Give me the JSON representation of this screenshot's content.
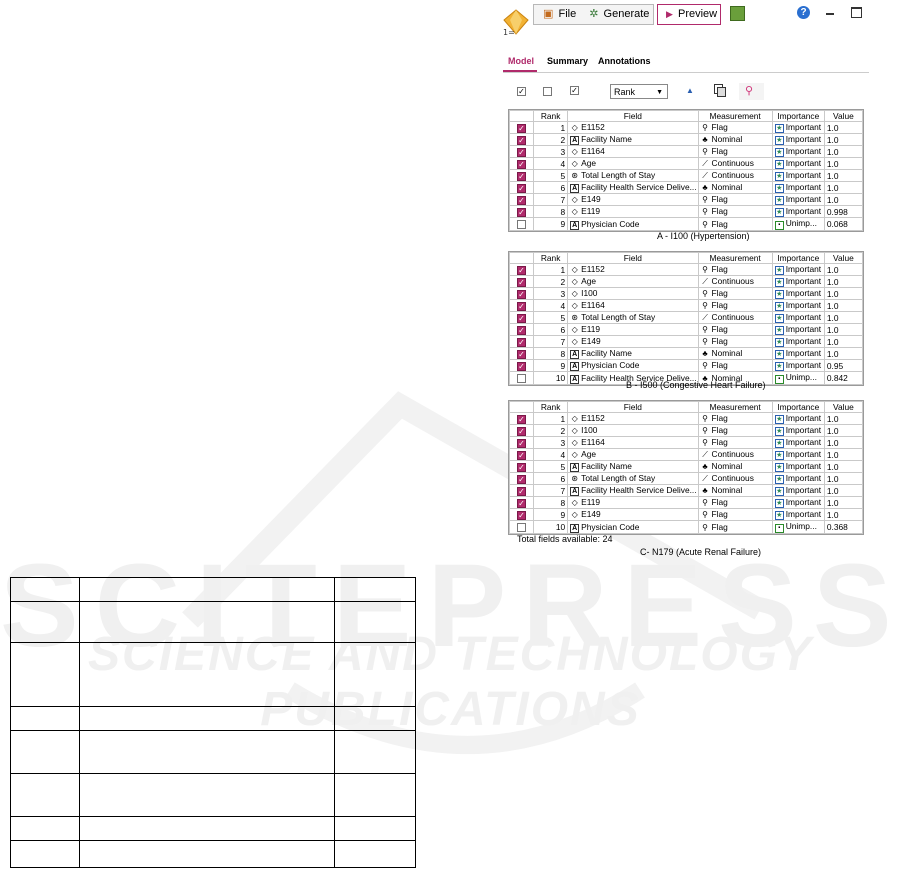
{
  "toolbar": {
    "file_label": "File",
    "generate_label": "Generate",
    "preview_label": "Preview"
  },
  "tabs": [
    "Model",
    "Summary",
    "Annotations"
  ],
  "sort_select": {
    "value": "Rank"
  },
  "columns": [
    "Rank",
    "Field",
    "Measurement",
    "Importance",
    "Value"
  ],
  "tables": [
    {
      "caption": "A - I100 (Hypertension)",
      "rows": [
        {
          "checked": true,
          "rank": "1",
          "icon": "flag",
          "field": "E1152",
          "mtype": "flag",
          "measurement": "Flag",
          "imp": "important",
          "importance": "Important",
          "value": "1.0"
        },
        {
          "checked": true,
          "rank": "2",
          "icon": "nominal",
          "field": "Facility Name",
          "mtype": "nominal",
          "measurement": "Nominal",
          "imp": "important",
          "importance": "Important",
          "value": "1.0"
        },
        {
          "checked": true,
          "rank": "3",
          "icon": "flag",
          "field": "E1164",
          "mtype": "flag",
          "measurement": "Flag",
          "imp": "important",
          "importance": "Important",
          "value": "1.0"
        },
        {
          "checked": true,
          "rank": "4",
          "icon": "flag",
          "field": "Age",
          "mtype": "continuous",
          "measurement": "Continuous",
          "imp": "important",
          "importance": "Important",
          "value": "1.0"
        },
        {
          "checked": true,
          "rank": "5",
          "icon": "continuous",
          "field": "Total Length of Stay",
          "mtype": "continuous",
          "measurement": "Continuous",
          "imp": "important",
          "importance": "Important",
          "value": "1.0"
        },
        {
          "checked": true,
          "rank": "6",
          "icon": "nominal",
          "field": "Facility Health Service Delive...",
          "mtype": "nominal",
          "measurement": "Nominal",
          "imp": "important",
          "importance": "Important",
          "value": "1.0"
        },
        {
          "checked": true,
          "rank": "7",
          "icon": "flag",
          "field": "E149",
          "mtype": "flag",
          "measurement": "Flag",
          "imp": "important",
          "importance": "Important",
          "value": "1.0"
        },
        {
          "checked": true,
          "rank": "8",
          "icon": "flag",
          "field": "E119",
          "mtype": "flag",
          "measurement": "Flag",
          "imp": "important",
          "importance": "Important",
          "value": "0.998"
        },
        {
          "checked": false,
          "rank": "9",
          "icon": "nominal",
          "field": "Physician Code",
          "mtype": "flag",
          "measurement": "Flag",
          "imp": "unimportant",
          "importance": "Unimp...",
          "value": "0.068"
        }
      ]
    },
    {
      "caption": "B - I500 (Congestive Heart Failure)",
      "rows": [
        {
          "checked": true,
          "rank": "1",
          "icon": "flag",
          "field": "E1152",
          "mtype": "flag",
          "measurement": "Flag",
          "imp": "important",
          "importance": "Important",
          "value": "1.0"
        },
        {
          "checked": true,
          "rank": "2",
          "icon": "flag",
          "field": "Age",
          "mtype": "continuous",
          "measurement": "Continuous",
          "imp": "important",
          "importance": "Important",
          "value": "1.0"
        },
        {
          "checked": true,
          "rank": "3",
          "icon": "flag",
          "field": "I100",
          "mtype": "flag",
          "measurement": "Flag",
          "imp": "important",
          "importance": "Important",
          "value": "1.0"
        },
        {
          "checked": true,
          "rank": "4",
          "icon": "flag",
          "field": "E1164",
          "mtype": "flag",
          "measurement": "Flag",
          "imp": "important",
          "importance": "Important",
          "value": "1.0"
        },
        {
          "checked": true,
          "rank": "5",
          "icon": "continuous",
          "field": "Total Length of Stay",
          "mtype": "continuous",
          "measurement": "Continuous",
          "imp": "important",
          "importance": "Important",
          "value": "1.0"
        },
        {
          "checked": true,
          "rank": "6",
          "icon": "flag",
          "field": "E119",
          "mtype": "flag",
          "measurement": "Flag",
          "imp": "important",
          "importance": "Important",
          "value": "1.0"
        },
        {
          "checked": true,
          "rank": "7",
          "icon": "flag",
          "field": "E149",
          "mtype": "flag",
          "measurement": "Flag",
          "imp": "important",
          "importance": "Important",
          "value": "1.0"
        },
        {
          "checked": true,
          "rank": "8",
          "icon": "nominal",
          "field": "Facility Name",
          "mtype": "nominal",
          "measurement": "Nominal",
          "imp": "important",
          "importance": "Important",
          "value": "1.0"
        },
        {
          "checked": true,
          "rank": "9",
          "icon": "nominal",
          "field": "Physician Code",
          "mtype": "flag",
          "measurement": "Flag",
          "imp": "important",
          "importance": "Important",
          "value": "0.95"
        },
        {
          "checked": false,
          "rank": "10",
          "icon": "nominal",
          "field": "Facility Health Service Delive...",
          "mtype": "nominal",
          "measurement": "Nominal",
          "imp": "unimportant",
          "importance": "Unimp...",
          "value": "0.842"
        }
      ]
    },
    {
      "caption": "C- N179 (Acute Renal Failure)",
      "rows": [
        {
          "checked": true,
          "rank": "1",
          "icon": "flag",
          "field": "E1152",
          "mtype": "flag",
          "measurement": "Flag",
          "imp": "important",
          "importance": "Important",
          "value": "1.0"
        },
        {
          "checked": true,
          "rank": "2",
          "icon": "flag",
          "field": "I100",
          "mtype": "flag",
          "measurement": "Flag",
          "imp": "important",
          "importance": "Important",
          "value": "1.0"
        },
        {
          "checked": true,
          "rank": "3",
          "icon": "flag",
          "field": "E1164",
          "mtype": "flag",
          "measurement": "Flag",
          "imp": "important",
          "importance": "Important",
          "value": "1.0"
        },
        {
          "checked": true,
          "rank": "4",
          "icon": "flag",
          "field": "Age",
          "mtype": "continuous",
          "measurement": "Continuous",
          "imp": "important",
          "importance": "Important",
          "value": "1.0"
        },
        {
          "checked": true,
          "rank": "5",
          "icon": "nominal",
          "field": "Facility Name",
          "mtype": "nominal",
          "measurement": "Nominal",
          "imp": "important",
          "importance": "Important",
          "value": "1.0"
        },
        {
          "checked": true,
          "rank": "6",
          "icon": "continuous",
          "field": "Total Length of Stay",
          "mtype": "continuous",
          "measurement": "Continuous",
          "imp": "important",
          "importance": "Important",
          "value": "1.0"
        },
        {
          "checked": true,
          "rank": "7",
          "icon": "nominal",
          "field": "Facility Health Service Delive...",
          "mtype": "nominal",
          "measurement": "Nominal",
          "imp": "important",
          "importance": "Important",
          "value": "1.0"
        },
        {
          "checked": true,
          "rank": "8",
          "icon": "flag",
          "field": "E119",
          "mtype": "flag",
          "measurement": "Flag",
          "imp": "important",
          "importance": "Important",
          "value": "1.0"
        },
        {
          "checked": true,
          "rank": "9",
          "icon": "flag",
          "field": "E149",
          "mtype": "flag",
          "measurement": "Flag",
          "imp": "important",
          "importance": "Important",
          "value": "1.0"
        },
        {
          "checked": false,
          "rank": "10",
          "icon": "nominal",
          "field": "Physician Code",
          "mtype": "flag",
          "measurement": "Flag",
          "imp": "unimportant",
          "importance": "Unimp...",
          "value": "0.368"
        }
      ]
    }
  ],
  "total_fields": "Total fields available: 24",
  "watermark": {
    "main": "SCITEPRESS",
    "sub": "SCIENCE AND TECHNOLOGY PUBLICATIONS"
  },
  "colors": {
    "accent": "#b02a6b",
    "important_star": "#2e8b57"
  }
}
